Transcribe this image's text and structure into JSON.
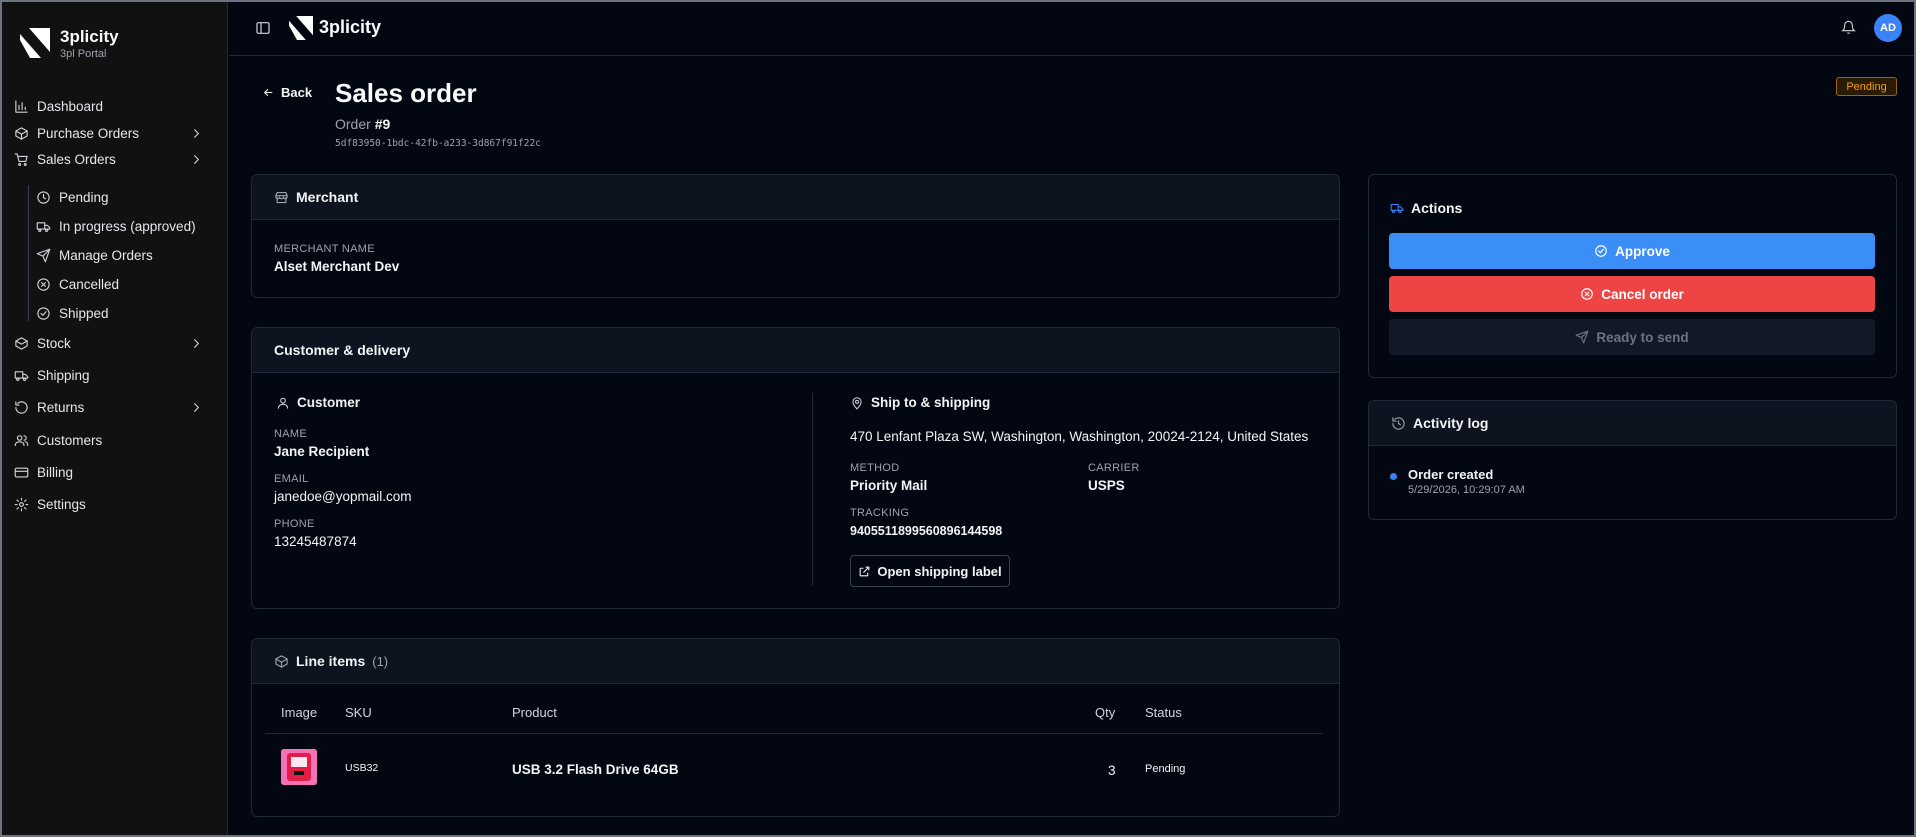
{
  "sidebar": {
    "brand_title": "3plicity",
    "brand_subtitle": "3pl Portal",
    "items": [
      {
        "label": "Dashboard",
        "icon": "chart-icon"
      },
      {
        "label": "Purchase Orders",
        "icon": "box-icon"
      },
      {
        "label": "Sales Orders",
        "icon": "cart-icon"
      },
      {
        "label": "Stock",
        "icon": "layers-icon"
      },
      {
        "label": "Shipping",
        "icon": "truck-icon"
      },
      {
        "label": "Returns",
        "icon": "rotate-icon"
      },
      {
        "label": "Customers",
        "icon": "users-icon"
      },
      {
        "label": "Billing",
        "icon": "card-icon"
      },
      {
        "label": "Settings",
        "icon": "gear-icon"
      }
    ],
    "sales_sub": [
      {
        "label": "Pending",
        "icon": "clock-icon"
      },
      {
        "label": "In progress (approved)",
        "icon": "truck-icon"
      },
      {
        "label": "Manage Orders",
        "icon": "send-icon"
      },
      {
        "label": "Cancelled",
        "icon": "x-circle-icon"
      },
      {
        "label": "Shipped",
        "icon": "check-circle-icon"
      }
    ]
  },
  "topbar": {
    "brand": "3plicity",
    "avatar_initials": "AD"
  },
  "header": {
    "back_label": "Back",
    "title": "Sales order",
    "order_prefix": "Order",
    "order_number": "#9",
    "uuid": "5df83950-1bdc-42fb-a233-3d867f91f22c",
    "status": "Pending"
  },
  "merchant": {
    "title": "Merchant",
    "name_label": "MERCHANT NAME",
    "name": "Alset Merchant Dev"
  },
  "customer_delivery": {
    "title": "Customer & delivery",
    "customer_title": "Customer",
    "name_label": "NAME",
    "name": "Jane Recipient",
    "email_label": "EMAIL",
    "email": "janedoe@yopmail.com",
    "phone_label": "PHONE",
    "phone": "13245487874",
    "ship_title": "Ship to & shipping",
    "address": "470 Lenfant Plaza SW, Washington, Washington, 20024-2124, United States",
    "method_label": "METHOD",
    "method": "Priority Mail",
    "carrier_label": "CARRIER",
    "carrier": "USPS",
    "tracking_label": "TRACKING",
    "tracking": "9405511899560896144598",
    "label_button": "Open shipping label"
  },
  "line_items": {
    "title": "Line items",
    "count": "(1)",
    "columns": [
      "Image",
      "SKU",
      "Product",
      "Qty",
      "Status"
    ],
    "rows": [
      {
        "sku": "USB32",
        "product": "USB 3.2 Flash Drive 64GB",
        "qty": "3",
        "status": "Pending"
      }
    ]
  },
  "actions": {
    "title": "Actions",
    "approve": "Approve",
    "cancel": "Cancel order",
    "ready": "Ready to send"
  },
  "activity": {
    "title": "Activity log",
    "events": [
      {
        "title": "Order created",
        "time": "5/29/2026, 10:29:07 AM"
      }
    ]
  },
  "colors": {
    "accent": "#3b82f6",
    "danger": "#ef4444",
    "pending": "#f59e0b",
    "background": "#030712"
  }
}
